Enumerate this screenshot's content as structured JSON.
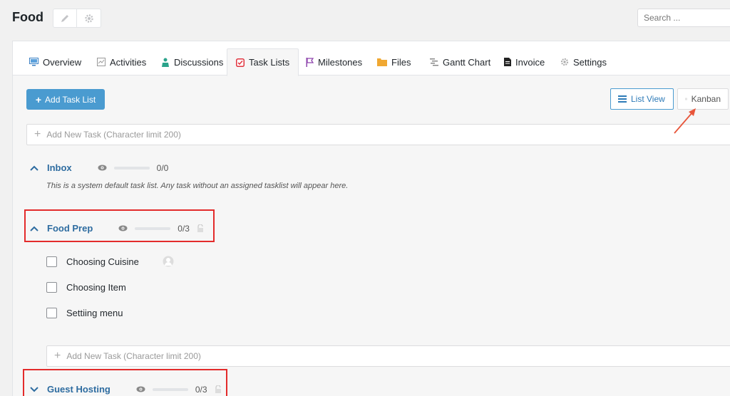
{
  "header": {
    "title": "Food",
    "search_placeholder": "Search ..."
  },
  "tabs": [
    {
      "label": "Overview",
      "icon": "monitor-icon"
    },
    {
      "label": "Activities",
      "icon": "activity-icon"
    },
    {
      "label": "Discussions",
      "icon": "people-icon"
    },
    {
      "label": "Task Lists",
      "icon": "checkbox-icon"
    },
    {
      "label": "Milestones",
      "icon": "flag-icon"
    },
    {
      "label": "Files",
      "icon": "folder-icon"
    },
    {
      "label": "Gantt Chart",
      "icon": "gantt-icon"
    },
    {
      "label": "Invoice",
      "icon": "document-icon"
    },
    {
      "label": "Settings",
      "icon": "gear-icon"
    }
  ],
  "active_tab": "Task Lists",
  "toolbar": {
    "add_task_list_label": "Add Task List",
    "list_view_label": "List View",
    "kanban_label": "Kanban"
  },
  "new_task_placeholder": "Add New Task (Character limit 200)",
  "task_lists": [
    {
      "name": "Inbox",
      "count": "0/0",
      "progress": 0,
      "description": "This is a system default task list. Any task without an assigned tasklist will appear here."
    },
    {
      "name": "Food Prep",
      "count": "0/3",
      "progress": 0,
      "tasks": [
        {
          "title": "Choosing Cuisine"
        },
        {
          "title": "Choosing Item"
        },
        {
          "title": "Settiing menu"
        }
      ]
    },
    {
      "name": "Guest Hosting",
      "count": "0/3",
      "progress": 0
    }
  ],
  "colors": {
    "primary": "#4a9bd0",
    "link": "#2e6ca0",
    "annotation_red": "#e32b2b"
  }
}
